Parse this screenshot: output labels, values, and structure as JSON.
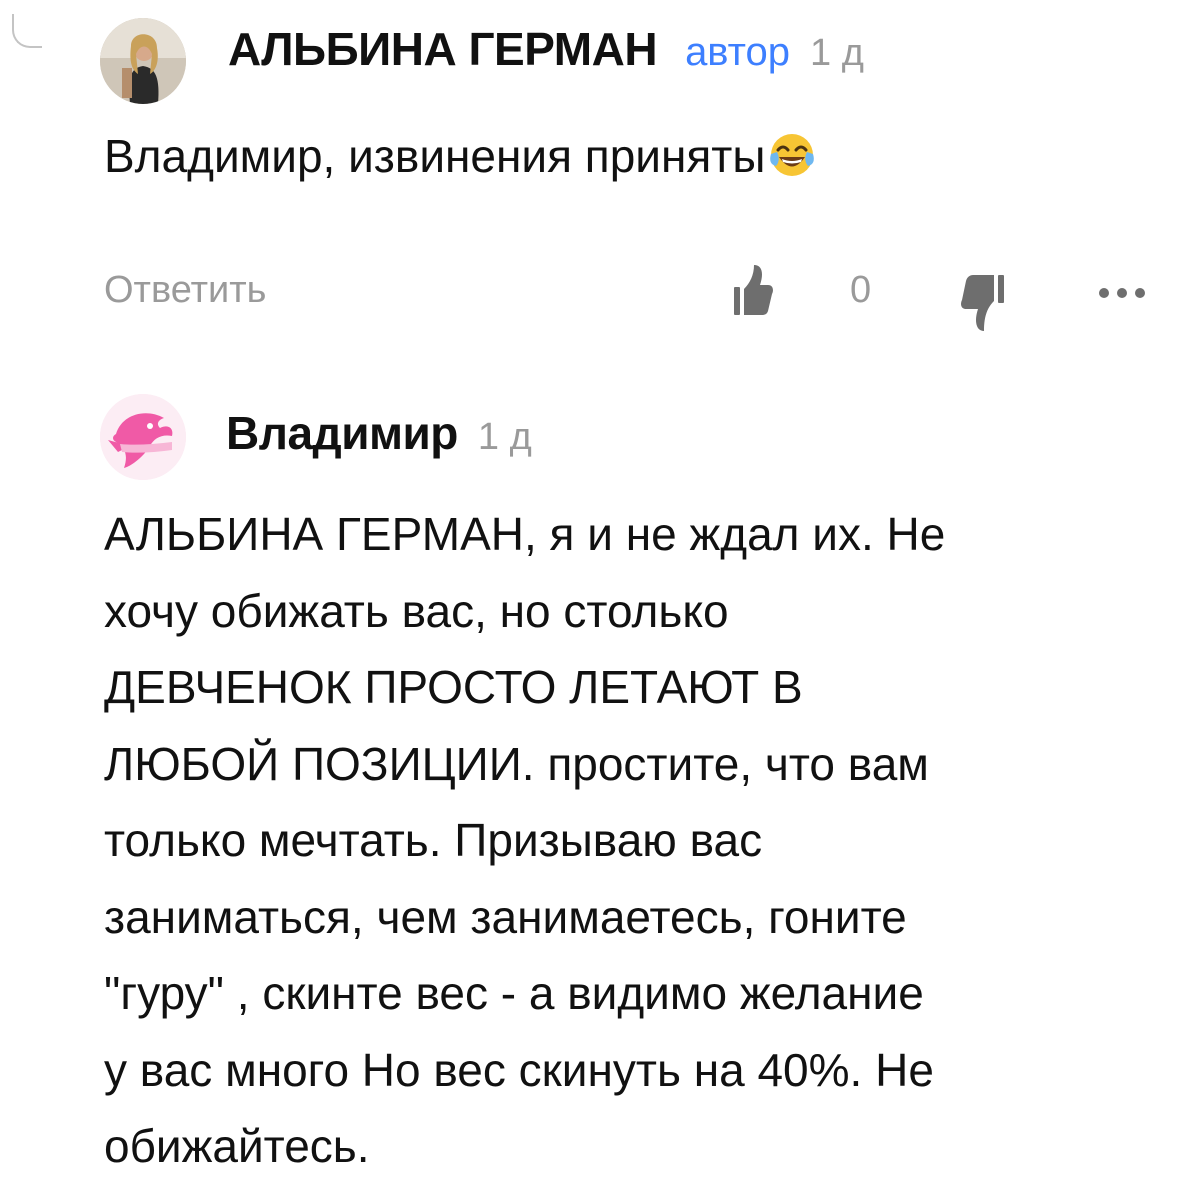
{
  "comments": [
    {
      "author": "АЛЬБИНА ГЕРМАН",
      "badge": "автор",
      "time": "1 д",
      "text": "Владимир, извинения приняты",
      "emoji": "face-with-tears-of-joy-icon",
      "actions": {
        "reply_label": "Ответить",
        "like_count": "0"
      }
    },
    {
      "author": "Владимир",
      "time": "1 д",
      "text": "АЛЬБИНА ГЕРМАН, я и не ждал их. Не\nхочу обижать вас, но столько\nДЕВЧЕНОК ПРОСТО ЛЕТАЮТ В\nЛЮБОЙ ПОЗИЦИИ. простите, что вам\nтолько мечтать. Призываю вас\nзаниматься, чем занимаетесь, гоните\n\"гуру\" , скинте вес - а видимо желание\nу вас много Но вес скинуть на 40%. Не\nобижайтесь."
    }
  ],
  "colors": {
    "author_badge": "#3d7fff",
    "muted": "#9a9a9a",
    "text": "#111111",
    "avatar_2_accent": "#f05aa6"
  }
}
